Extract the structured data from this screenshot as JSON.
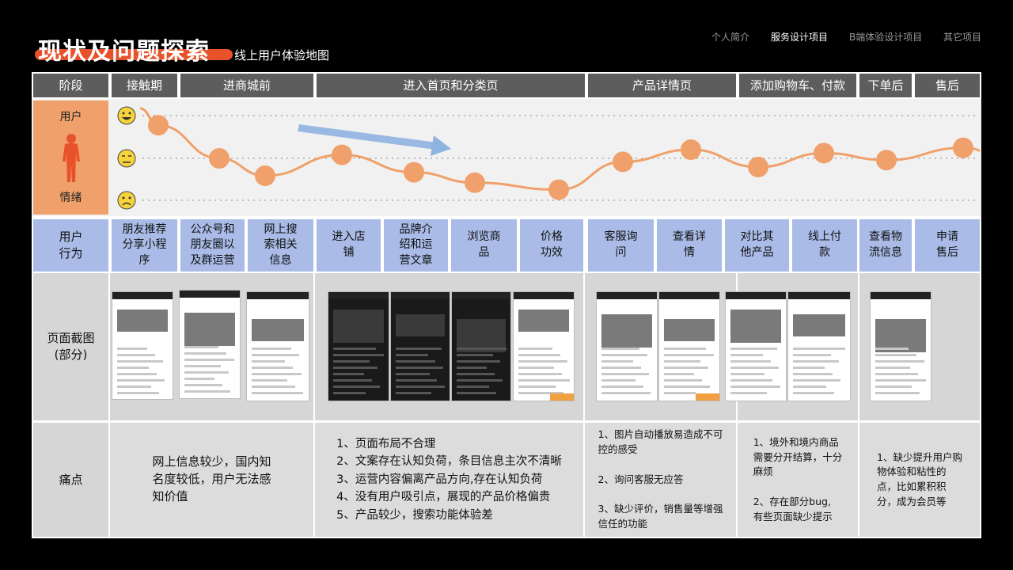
{
  "header": {
    "title": "现状及问题探索",
    "subtitle": "线上用户体验地图",
    "nav": [
      {
        "label": "个人简介",
        "active": false
      },
      {
        "label": "服务设计项目",
        "active": true
      },
      {
        "label": "B端体验设计项目",
        "active": false
      },
      {
        "label": "其它项目",
        "active": false
      }
    ]
  },
  "stages": {
    "label": "阶段",
    "items": [
      "接触期",
      "进商城前",
      "进入首页和分类页",
      "产品详情页",
      "添加购物车、付款",
      "下单后",
      "售后"
    ]
  },
  "emotion": {
    "user_label": "用户",
    "emotion_label": "情绪",
    "faces": [
      "happy-face-icon",
      "neutral-face-icon",
      "sad-face-icon"
    ],
    "points": [
      88,
      50,
      30,
      54,
      34,
      22,
      14,
      46,
      60,
      40,
      56,
      48,
      62,
      72,
      84,
      62
    ],
    "colors": {
      "curve": "#f0a06a",
      "arrow": "#8fb3e0"
    }
  },
  "behavior": {
    "label_line1": "用户",
    "label_line2": "行为",
    "items": [
      [
        "朋友推荐",
        "分享小程序"
      ],
      [
        "公众号和",
        "朋友圈以",
        "及群运营"
      ],
      [
        "网上搜",
        "索相关",
        "信息"
      ],
      [
        "进入店",
        "铺"
      ],
      [
        "品牌介",
        "绍和运",
        "营文章"
      ],
      [
        "浏览商",
        "品"
      ],
      [
        "价格",
        "功效"
      ],
      [
        "客服询",
        "问"
      ],
      [
        "查看详",
        "情"
      ],
      [
        "对比其",
        "他产品"
      ],
      [
        "线上付",
        "款"
      ],
      [
        "查看物",
        "流信息"
      ],
      [
        "申请",
        "售后"
      ]
    ]
  },
  "screens": {
    "label_line1": "页面截图",
    "label_line2": "(部分)"
  },
  "pain": {
    "label": "痛点",
    "col1": [
      "网上信息较少，国内知",
      "名度较低，用户无法感",
      "知价值"
    ],
    "col2": [
      "1、页面布局不合理",
      "2、文案存在认知负荷，条目信息主次不清晰",
      "3、运营内容偏离产品方向,存在认知负荷",
      "4、没有用户吸引点，展现的产品价格偏贵",
      "5、产品较少，搜索功能体验差"
    ],
    "col3": [
      "1、图片自动播放易造成不可",
      "控的感受",
      "",
      "2、询问客服无应答",
      "",
      "3、缺少评价，销售量等增强",
      "信任的功能"
    ],
    "col4": [
      "1、境外和境内商品",
      "需要分开结算，十分",
      "麻烦",
      "",
      "2、存在部分bug,",
      "有些页面缺少提示"
    ],
    "col5": [
      "1、缺少提升用户购",
      "物体验和粘性的",
      "点，比如累积积",
      "分，成为会员等"
    ]
  }
}
